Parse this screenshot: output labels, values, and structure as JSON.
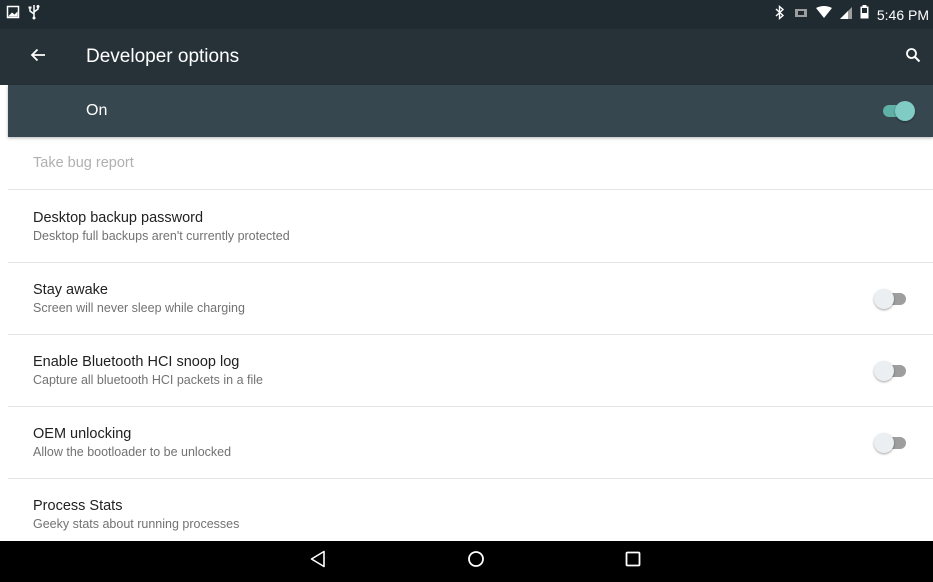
{
  "status_bar": {
    "time": "5:46 PM",
    "left_icons": [
      "image-icon",
      "usb-icon"
    ],
    "right_icons": [
      "bluetooth-icon",
      "vibrate-icon",
      "wifi-icon",
      "signal-icon",
      "battery-icon"
    ]
  },
  "app_bar": {
    "title": "Developer options"
  },
  "master_switch": {
    "label": "On",
    "checked": true
  },
  "settings": [
    {
      "title": "Take bug report",
      "enabled": false
    },
    {
      "title": "Desktop backup password",
      "summary": "Desktop full backups aren't currently protected"
    },
    {
      "title": "Stay awake",
      "summary": "Screen will never sleep while charging",
      "toggle": false
    },
    {
      "title": "Enable Bluetooth HCI snoop log",
      "summary": "Capture all bluetooth HCI packets in a file",
      "toggle": false
    },
    {
      "title": "OEM unlocking",
      "summary": "Allow the bootloader to be unlocked",
      "toggle": false
    },
    {
      "title": "Process Stats",
      "summary": "Geeky stats about running processes"
    }
  ],
  "nav_bar": {
    "buttons": [
      "back-icon",
      "home-icon",
      "recents-icon"
    ]
  },
  "colors": {
    "status_bar": "#1f2b30",
    "app_bar": "#263238",
    "master_bar": "#37474f",
    "accent": "#80cbc4"
  }
}
